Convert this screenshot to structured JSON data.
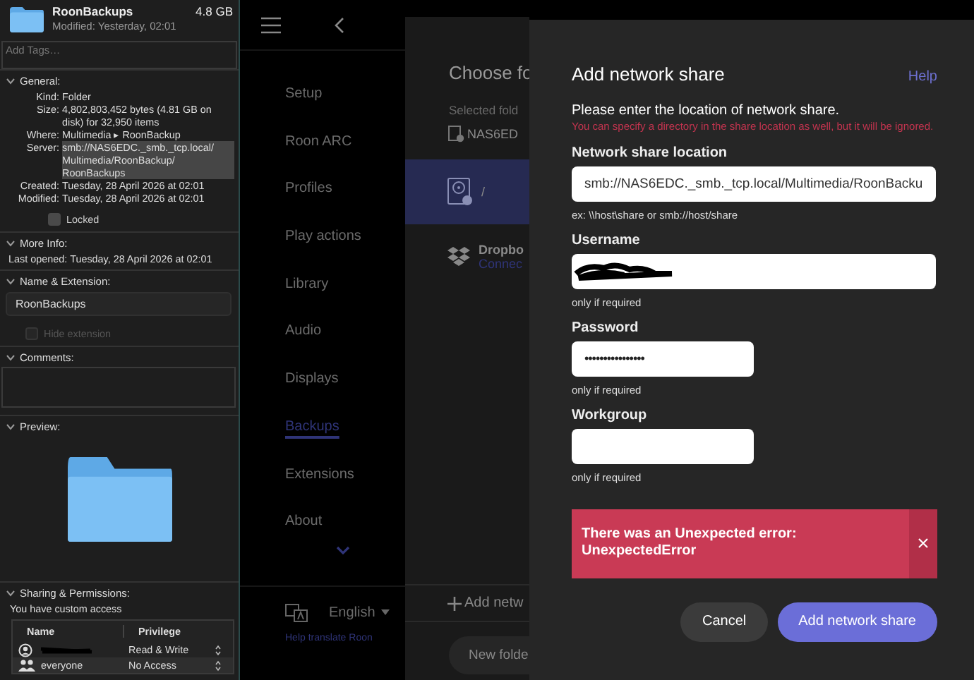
{
  "finder_info": {
    "header": {
      "name": "RoonBackups",
      "size": "4.8 GB",
      "modified": "Modified: Yesterday, 02:01"
    },
    "tags_field": {
      "placeholder": "Add Tags…"
    },
    "sections": [
      {
        "kind": "general",
        "title": "General:",
        "expanded": true,
        "rows": [
          {
            "label": "Kind:",
            "value": "Folder",
            "highlighted": false
          },
          {
            "label": "Size:",
            "value": "4,802,803,452 bytes (4.81 GB on disk) for 32,950 items",
            "highlighted": false
          },
          {
            "label": "Where:",
            "value": "Multimedia ▸ RoonBackup",
            "highlighted": false
          },
          {
            "label": "Server:",
            "value": "smb://NAS6EDC._smb._tcp.local/ Multimedia/RoonBackup/ RoonBackups",
            "highlighted": true
          },
          {
            "label": "Created:",
            "value": "Tuesday, 28 April 2026 at 02:01",
            "highlighted": false
          },
          {
            "label": "Modified:",
            "value": "Tuesday, 28 April 2026 at 02:01",
            "highlighted": false
          }
        ],
        "checkbox": {
          "label": "Locked",
          "checked": false,
          "disabled": false
        }
      },
      {
        "kind": "more_info",
        "title": "More Info:",
        "expanded": true,
        "rows": [
          {
            "label": "Last opened:",
            "value": "Tuesday, 28 April 2026 at 02:01",
            "highlighted": false
          }
        ]
      },
      {
        "kind": "name_extension",
        "title": "Name & Extension:",
        "expanded": true,
        "value": "RoonBackups",
        "checkbox": {
          "label": "Hide extension",
          "checked": false,
          "disabled": true
        }
      },
      {
        "kind": "comments",
        "title": "Comments:",
        "expanded": true
      },
      {
        "kind": "preview",
        "title": "Preview:",
        "expanded": true
      },
      {
        "kind": "sharing",
        "title": "Sharing & Permissions:",
        "expanded": true,
        "note": "You have custom access",
        "columns": [
          "Name",
          "Privilege"
        ],
        "rows": [
          {
            "kind": "user",
            "redacted": true,
            "privilege": "Read & Write"
          },
          {
            "kind": "group",
            "redacted": false,
            "name": "everyone",
            "privilege": "No Access"
          }
        ]
      }
    ]
  },
  "sidebar": {
    "items": [
      {
        "label": "Setup",
        "selected": false
      },
      {
        "label": "Roon ARC",
        "selected": false
      },
      {
        "label": "Profiles",
        "selected": false
      },
      {
        "label": "Play actions",
        "selected": false
      },
      {
        "label": "Library",
        "selected": false
      },
      {
        "label": "Audio",
        "selected": false
      },
      {
        "label": "Displays",
        "selected": false
      },
      {
        "label": "Backups",
        "selected": true
      },
      {
        "label": "Extensions",
        "selected": false
      },
      {
        "label": "About",
        "selected": false
      }
    ],
    "language": "English",
    "help_link": "Help translate Roon"
  },
  "folder_panel": {
    "title": "Choose fo",
    "selected_label": "Selected fold",
    "selected_value": "NAS6ED",
    "locations": [
      {
        "kind": "drive",
        "label": "/",
        "selected": true
      },
      {
        "kind": "dropbox",
        "label": "Dropbo",
        "status": "Connec",
        "selected": false
      }
    ],
    "add_link": "Add netw",
    "new_folder": "New folde"
  },
  "dialog": {
    "title": "Add network share",
    "help": "Help",
    "intro": "Please enter the location of network share.",
    "note": "You can specify a directory in the share location as well, but it will be ignored.",
    "fields": [
      {
        "kind": "location",
        "label": "Network share location",
        "value": "smb://NAS6EDC._smb._tcp.local/Multimedia/RoonBacku",
        "hint": "ex: \\\\host\\share or smb://host/share"
      },
      {
        "kind": "username",
        "label": "Username",
        "redacted": true,
        "hint": "only if required"
      },
      {
        "kind": "password",
        "label": "Password",
        "value": "••••••••••••••••",
        "hint": "only if required"
      },
      {
        "kind": "workgroup",
        "label": "Workgroup",
        "hint": "only if required"
      }
    ],
    "error": {
      "message": "There was an Unexpected error: UnexpectedError"
    },
    "buttons": [
      {
        "kind": "secondary",
        "label": "Cancel"
      },
      {
        "kind": "primary",
        "label": "Add network share"
      }
    ]
  }
}
